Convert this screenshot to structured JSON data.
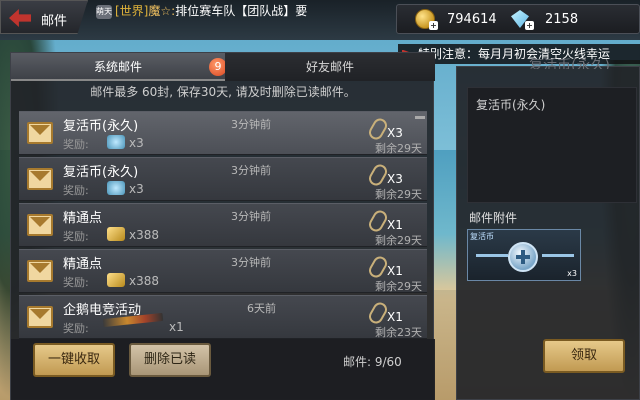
{
  "header": {
    "title": "邮件",
    "chat": {
      "avatar": "萌天",
      "channel": "[世界]",
      "sender": "魔☆:",
      "message": "排位赛车队【团队战】要"
    },
    "currency": {
      "coins": "794614",
      "gems": "2158"
    }
  },
  "notice": "特别注意：每月月初会清空火线幸运",
  "mail": {
    "tabs": [
      {
        "label": "系统邮件",
        "badge": "9"
      },
      {
        "label": "好友邮件"
      }
    ],
    "info": "邮件最多 60封, 保存30天, 请及时删除已读邮件。",
    "reward_label": "奖励:",
    "items": [
      {
        "title": "复活币(永久)",
        "time": "3分钟前",
        "reward_icon": "revive-coin-icon",
        "reward_qty": "x3",
        "attach_qty": "X3",
        "remaining": "剩余29天"
      },
      {
        "title": "复活币(永久)",
        "time": "3分钟前",
        "reward_icon": "revive-coin-icon",
        "reward_qty": "x3",
        "attach_qty": "X3",
        "remaining": "剩余29天"
      },
      {
        "title": "精通点",
        "time": "3分钟前",
        "reward_icon": "mastery-point-icon",
        "reward_qty": "x388",
        "attach_qty": "X1",
        "remaining": "剩余29天"
      },
      {
        "title": "精通点",
        "time": "3分钟前",
        "reward_icon": "mastery-point-icon",
        "reward_qty": "x388",
        "attach_qty": "X1",
        "remaining": "剩余29天"
      },
      {
        "title": "企鹅电竞活动",
        "time": "6天前",
        "reward_icon": "rifle-icon",
        "reward_qty": "x1",
        "attach_qty": "X1",
        "remaining": "剩余23天"
      }
    ],
    "collect_all": "一键收取",
    "delete_read": "删除已读",
    "count": "邮件: 9/60"
  },
  "detail": {
    "header": "复活币(永久)",
    "body": "复活币(永久)",
    "attachments_label": "邮件附件",
    "attachment": {
      "name": "复活币",
      "qty": "x3",
      "icon": "revive-coin-icon"
    },
    "claim": "领取"
  }
}
